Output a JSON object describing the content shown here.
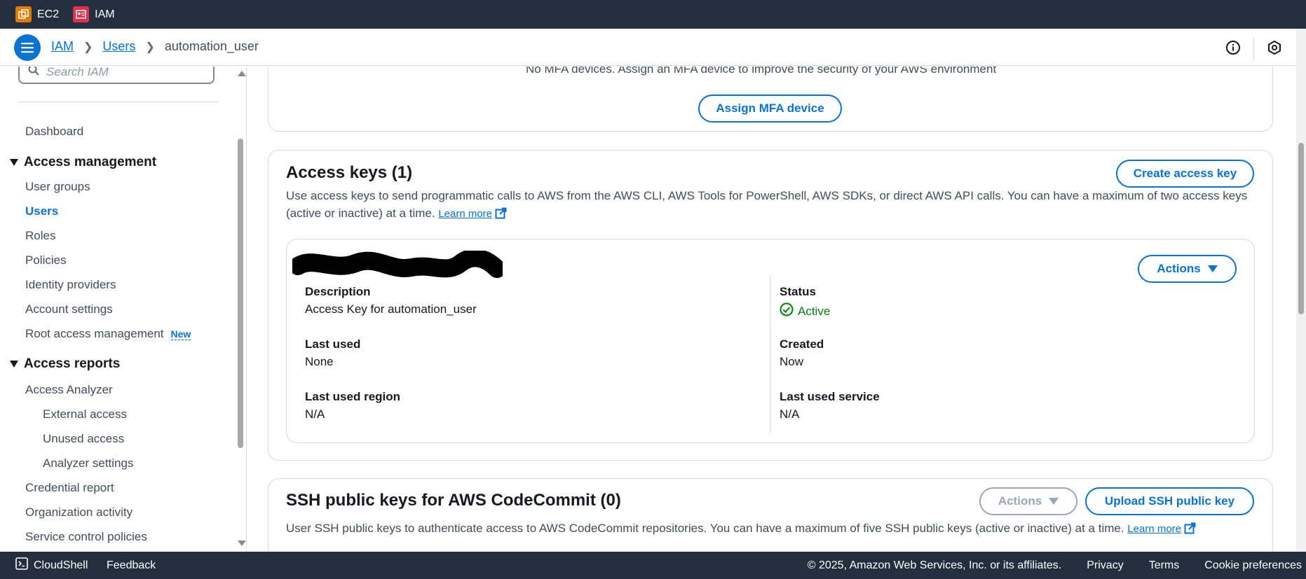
{
  "topbar": {
    "services": [
      {
        "name": "EC2",
        "icon": "ec2-icon",
        "color": "#e07b00"
      },
      {
        "name": "IAM",
        "icon": "iam-icon",
        "color": "#dd344c"
      }
    ]
  },
  "header": {
    "breadcrumb": [
      "IAM",
      "Users",
      "automation_user"
    ]
  },
  "sidebar": {
    "search_placeholder": "Search IAM",
    "dashboard": "Dashboard",
    "sections": [
      {
        "title": "Access management",
        "items": [
          "User groups",
          "Users",
          "Roles",
          "Policies",
          "Identity providers",
          "Account settings",
          "Root access management"
        ],
        "active": "Users",
        "badge": "New"
      },
      {
        "title": "Access reports",
        "items": [
          "Access Analyzer",
          "External access",
          "Unused access",
          "Analyzer settings",
          "Credential report",
          "Organization activity",
          "Service control policies"
        ]
      }
    ]
  },
  "mfa": {
    "note": "No MFA devices. Assign an MFA device to improve the security of your AWS environment",
    "button": "Assign MFA device"
  },
  "access_keys": {
    "title": "Access keys (1)",
    "create_button": "Create access key",
    "description": "Use access keys to send programmatic calls to AWS from the AWS CLI, AWS Tools for PowerShell, AWS SDKs, or direct AWS API calls. You can have a maximum of two access keys (active or inactive) at a time.",
    "learn_more": "Learn more",
    "key": {
      "actions": "Actions",
      "description_label": "Description",
      "description_value": "Access Key for automation_user",
      "status_label": "Status",
      "status_value": "Active",
      "last_used_label": "Last used",
      "last_used_value": "None",
      "created_label": "Created",
      "created_value": "Now",
      "region_label": "Last used region",
      "region_value": "N/A",
      "service_label": "Last used service",
      "service_value": "N/A"
    }
  },
  "ssh": {
    "title": "SSH public keys for AWS CodeCommit (0)",
    "actions": "Actions",
    "upload_button": "Upload SSH public key",
    "description": "User SSH public keys to authenticate access to AWS CodeCommit repositories. You can have a maximum of five SSH public keys (active or inactive) at a time.",
    "learn_more": "Learn more"
  },
  "footer": {
    "cloudshell": "CloudShell",
    "feedback": "Feedback",
    "copyright": "© 2025, Amazon Web Services, Inc. or its affiliates.",
    "privacy": "Privacy",
    "terms": "Terms",
    "cookies": "Cookie preferences"
  },
  "colors": {
    "accent": "#0972d3",
    "navbar": "#232f3e",
    "success": "#037f0c"
  }
}
